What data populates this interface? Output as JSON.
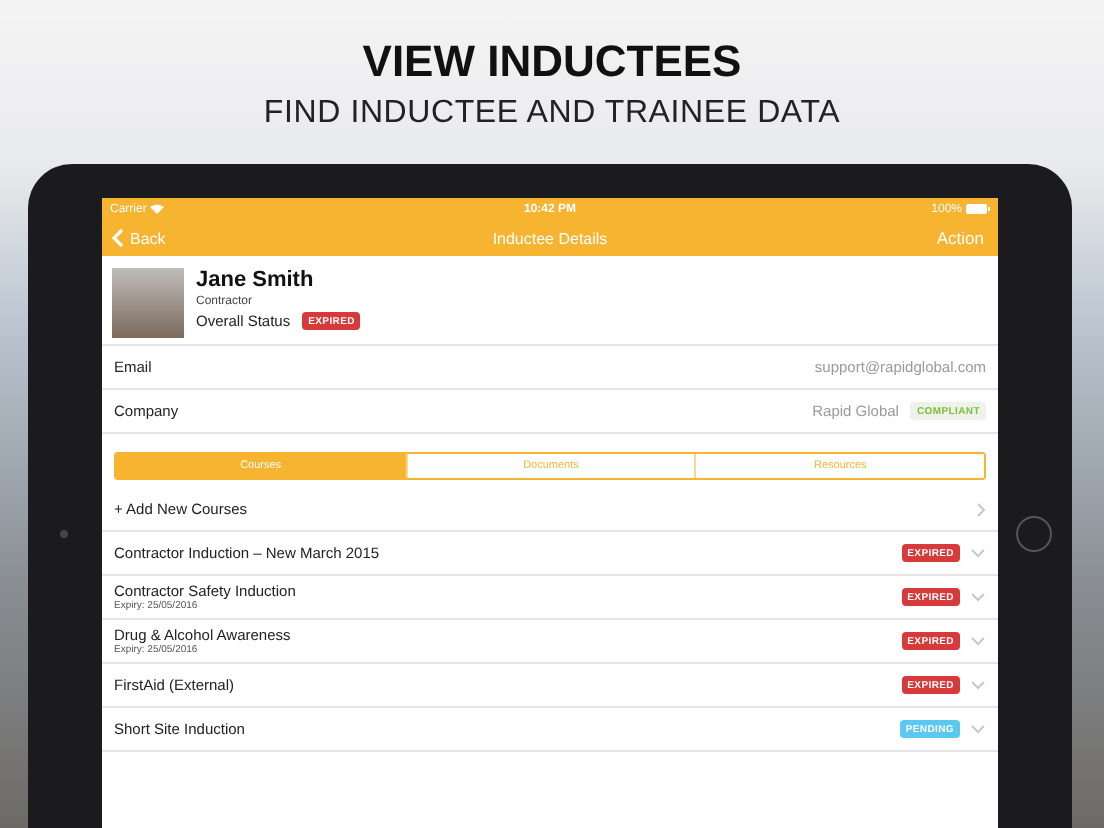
{
  "hero": {
    "title": "VIEW INDUCTEES",
    "subtitle": "FIND INDUCTEE AND TRAINEE DATA"
  },
  "status_bar": {
    "carrier": "Carrier",
    "time": "10:42 PM",
    "battery": "100%"
  },
  "nav": {
    "back": "Back",
    "title": "Inductee Details",
    "action": "Action"
  },
  "profile": {
    "name": "Jane Smith",
    "role": "Contractor",
    "status_label": "Overall Status",
    "status": {
      "kind": "expired",
      "text": "EXPIRED"
    }
  },
  "fields": [
    {
      "label": "Email",
      "value": "support@rapidglobal.com"
    },
    {
      "label": "Company",
      "value": "Rapid Global",
      "status": {
        "kind": "compliant",
        "text": "COMPLIANT"
      }
    }
  ],
  "tabs": [
    {
      "label": "Courses",
      "selected": true
    },
    {
      "label": "Documents",
      "selected": false
    },
    {
      "label": "Resources",
      "selected": false
    }
  ],
  "add_course": "+ Add New Courses",
  "courses": [
    {
      "name": "Contractor Induction – New March 2015",
      "status": {
        "kind": "expired",
        "text": "EXPIRED"
      }
    },
    {
      "name": "Contractor Safety Induction",
      "expiry": "Expiry: 25/05/2016",
      "status": {
        "kind": "expired",
        "text": "EXPIRED"
      }
    },
    {
      "name": "Drug & Alcohol Awareness",
      "expiry": "Expiry: 25/05/2016",
      "status": {
        "kind": "expired",
        "text": "EXPIRED"
      }
    },
    {
      "name": "FirstAid (External)",
      "status": {
        "kind": "expired",
        "text": "EXPIRED"
      }
    },
    {
      "name": "Short Site Induction",
      "status": {
        "kind": "pending",
        "text": "PENDING"
      }
    }
  ]
}
